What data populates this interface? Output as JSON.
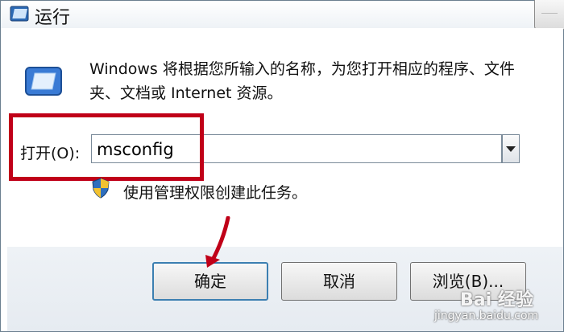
{
  "window": {
    "title": "运行"
  },
  "description": "Windows 将根据您所输入的名称，为您打开相应的程序、文件夹、文档或 Internet 资源。",
  "open_field": {
    "label": "打开(O):",
    "value": "msconfig"
  },
  "admin_note": "使用管理权限创建此任务。",
  "buttons": {
    "ok": "确定",
    "cancel": "取消",
    "browse": "浏览(B)..."
  },
  "watermark": {
    "logo": "Bai 经验",
    "url": "jingyan.baidu.com"
  },
  "colors": {
    "highlight_box": "#c00018",
    "arrow": "#c00018",
    "default_button_border": "#3c7fb1"
  },
  "icons": [
    "run-icon",
    "close-icon",
    "dropdown-arrow-icon",
    "uac-shield-icon"
  ]
}
